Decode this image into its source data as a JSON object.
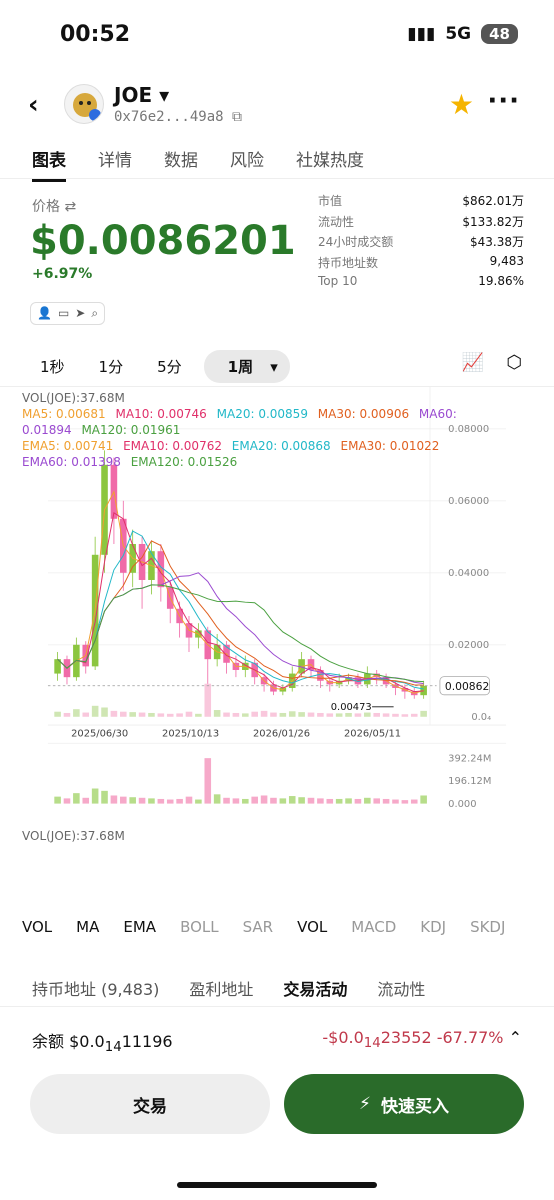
{
  "status_bar": {
    "time": "00:52",
    "network": "5G",
    "battery": "48"
  },
  "header": {
    "token_name": "JOE",
    "token_address": "0x76e2...49a8"
  },
  "tabs": [
    "图表",
    "详情",
    "数据",
    "风险",
    "社媒热度"
  ],
  "price": {
    "label": "价格",
    "value": "$0.0086201",
    "change": "+6.97%"
  },
  "stats": [
    {
      "k": "市值",
      "v": "$862.01万"
    },
    {
      "k": "流动性",
      "v": "$133.82万"
    },
    {
      "k": "24小时成交额",
      "v": "$43.38万"
    },
    {
      "k": "持币地址数",
      "v": "9,483"
    },
    {
      "k": "Top 10",
      "v": "19.86%"
    }
  ],
  "intervals": [
    "1秒",
    "1分",
    "5分",
    "1周"
  ],
  "legend": {
    "vol_top": "VOL(JOE):37.68M",
    "ma": [
      {
        "label": "MA5: 0.00681",
        "color": "#f0a030"
      },
      {
        "label": "MA10: 0.00746",
        "color": "#e0306a"
      },
      {
        "label": "MA20: 0.00859",
        "color": "#22b8c8"
      },
      {
        "label": "MA30: 0.00906",
        "color": "#e06020"
      },
      {
        "label": "MA60: 0.01894",
        "color": "#9a4ad0"
      },
      {
        "label": "MA120: 0.01961",
        "color": "#4aa040"
      }
    ],
    "ema": [
      {
        "label": "EMA5: 0.00741",
        "color": "#f0a030"
      },
      {
        "label": "EMA10: 0.00762",
        "color": "#e0306a"
      },
      {
        "label": "EMA20: 0.00868",
        "color": "#22b8c8"
      },
      {
        "label": "EMA30: 0.01022",
        "color": "#e06020"
      },
      {
        "label": "EMA60: 0.01398",
        "color": "#9a4ad0"
      },
      {
        "label": "EMA120: 0.01526",
        "color": "#4aa040"
      }
    ],
    "vol_bottom": "VOL(JOE):37.68M"
  },
  "chart_data": {
    "type": "candlestick",
    "price_axis": [
      "0.08000",
      "0.06000",
      "0.04000",
      "0.02000",
      "0.0₄"
    ],
    "price_ylim": [
      0,
      0.085
    ],
    "x_labels": [
      "2025/06/30",
      "2025/10/13",
      "2026/01/26",
      "2026/05/11"
    ],
    "current_price": "0.00862",
    "low_marker": "0.00473",
    "volume_axis": [
      "392.24M",
      "196.12M",
      "0.000"
    ],
    "volume_max": 392.24,
    "candles": [
      {
        "o": 0.012,
        "c": 0.016,
        "h": 0.018,
        "l": 0.01
      },
      {
        "o": 0.016,
        "c": 0.011,
        "h": 0.017,
        "l": 0.009
      },
      {
        "o": 0.011,
        "c": 0.02,
        "h": 0.022,
        "l": 0.01
      },
      {
        "o": 0.02,
        "c": 0.014,
        "h": 0.021,
        "l": 0.012
      },
      {
        "o": 0.014,
        "c": 0.045,
        "h": 0.05,
        "l": 0.013
      },
      {
        "o": 0.045,
        "c": 0.07,
        "h": 0.074,
        "l": 0.04
      },
      {
        "o": 0.07,
        "c": 0.055,
        "h": 0.072,
        "l": 0.048
      },
      {
        "o": 0.055,
        "c": 0.04,
        "h": 0.06,
        "l": 0.035
      },
      {
        "o": 0.04,
        "c": 0.048,
        "h": 0.052,
        "l": 0.036
      },
      {
        "o": 0.048,
        "c": 0.038,
        "h": 0.05,
        "l": 0.03
      },
      {
        "o": 0.038,
        "c": 0.046,
        "h": 0.049,
        "l": 0.034
      },
      {
        "o": 0.046,
        "c": 0.036,
        "h": 0.048,
        "l": 0.032
      },
      {
        "o": 0.036,
        "c": 0.03,
        "h": 0.038,
        "l": 0.026
      },
      {
        "o": 0.03,
        "c": 0.026,
        "h": 0.032,
        "l": 0.022
      },
      {
        "o": 0.026,
        "c": 0.022,
        "h": 0.028,
        "l": 0.018
      },
      {
        "o": 0.022,
        "c": 0.024,
        "h": 0.026,
        "l": 0.019
      },
      {
        "o": 0.024,
        "c": 0.016,
        "h": 0.025,
        "l": 0.008
      },
      {
        "o": 0.016,
        "c": 0.02,
        "h": 0.023,
        "l": 0.014
      },
      {
        "o": 0.02,
        "c": 0.015,
        "h": 0.021,
        "l": 0.012
      },
      {
        "o": 0.015,
        "c": 0.013,
        "h": 0.017,
        "l": 0.011
      },
      {
        "o": 0.013,
        "c": 0.015,
        "h": 0.017,
        "l": 0.011
      },
      {
        "o": 0.015,
        "c": 0.011,
        "h": 0.016,
        "l": 0.009
      },
      {
        "o": 0.011,
        "c": 0.009,
        "h": 0.012,
        "l": 0.007
      },
      {
        "o": 0.009,
        "c": 0.007,
        "h": 0.01,
        "l": 0.006
      },
      {
        "o": 0.007,
        "c": 0.008,
        "h": 0.009,
        "l": 0.006
      },
      {
        "o": 0.008,
        "c": 0.012,
        "h": 0.014,
        "l": 0.007
      },
      {
        "o": 0.012,
        "c": 0.016,
        "h": 0.018,
        "l": 0.011
      },
      {
        "o": 0.016,
        "c": 0.013,
        "h": 0.017,
        "l": 0.011
      },
      {
        "o": 0.013,
        "c": 0.01,
        "h": 0.014,
        "l": 0.008
      },
      {
        "o": 0.01,
        "c": 0.009,
        "h": 0.011,
        "l": 0.007
      },
      {
        "o": 0.009,
        "c": 0.01,
        "h": 0.012,
        "l": 0.008
      },
      {
        "o": 0.01,
        "c": 0.011,
        "h": 0.012,
        "l": 0.009
      },
      {
        "o": 0.011,
        "c": 0.009,
        "h": 0.012,
        "l": 0.008
      },
      {
        "o": 0.009,
        "c": 0.012,
        "h": 0.014,
        "l": 0.008
      },
      {
        "o": 0.012,
        "c": 0.011,
        "h": 0.013,
        "l": 0.009
      },
      {
        "o": 0.011,
        "c": 0.009,
        "h": 0.012,
        "l": 0.008
      },
      {
        "o": 0.009,
        "c": 0.008,
        "h": 0.01,
        "l": 0.006
      },
      {
        "o": 0.008,
        "c": 0.007,
        "h": 0.009,
        "l": 0.005
      },
      {
        "o": 0.007,
        "c": 0.006,
        "h": 0.008,
        "l": 0.005
      },
      {
        "o": 0.006,
        "c": 0.0086,
        "h": 0.01,
        "l": 0.005
      }
    ],
    "volumes": [
      60,
      45,
      90,
      50,
      130,
      110,
      70,
      60,
      55,
      50,
      45,
      40,
      35,
      40,
      60,
      35,
      392,
      80,
      50,
      45,
      40,
      60,
      70,
      50,
      45,
      65,
      55,
      50,
      45,
      40,
      40,
      45,
      40,
      50,
      45,
      40,
      35,
      30,
      35,
      70
    ]
  }
}
